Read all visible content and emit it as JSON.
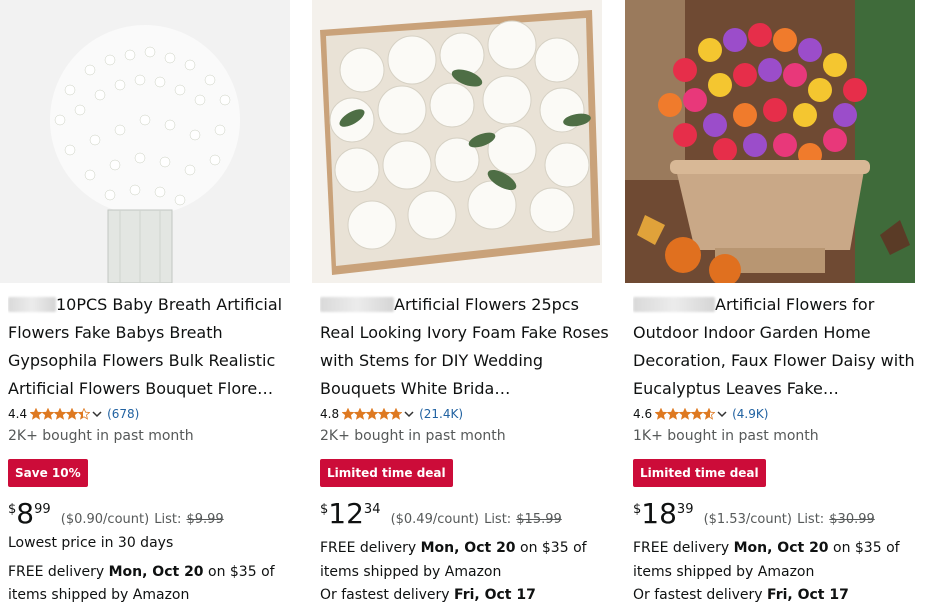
{
  "products": [
    {
      "title": "10PCS Baby Breath Artificial Flowers Fake Babys Breath Gypsophila Flowers Bulk Realistic Artificial Flowers Bouquet Flore…",
      "rating": "4.4",
      "rating_value": 4.4,
      "review_count": "(678)",
      "bought": "2K+ bought in past month",
      "badge": "Save 10%",
      "price_symbol": "$",
      "price_whole": "8",
      "price_fraction": "99",
      "unit_price": "($0.90/count)",
      "list_label": "List:",
      "list_price": "$9.99",
      "extra_line": "Lowest price in 30 days",
      "delivery_prefix": "FREE delivery ",
      "delivery_date": "Mon, Oct 20",
      "delivery_suffix": " on $35 of",
      "delivery_line2": "items shipped by Amazon"
    },
    {
      "title": "Artificial Flowers 25pcs Real Looking Ivory Foam Fake Roses with Stems for DIY Wedding Bouquets White Brida…",
      "rating": "4.8",
      "rating_value": 4.8,
      "review_count": "(21.4K)",
      "bought": "2K+ bought in past month",
      "badge": "Limited time deal",
      "price_symbol": "$",
      "price_whole": "12",
      "price_fraction": "34",
      "unit_price": "($0.49/count)",
      "list_label": "List:",
      "list_price": "$15.99",
      "delivery_prefix": "FREE delivery ",
      "delivery_date": "Mon, Oct 20",
      "delivery_suffix": " on $35 of",
      "delivery_line2": "items shipped by Amazon",
      "fastest_prefix": "Or fastest delivery ",
      "fastest_date": "Fri, Oct 17"
    },
    {
      "title": "Artificial Flowers for Outdoor Indoor Garden Home Decoration, Faux Flower Daisy with Eucalyptus Leaves Fake…",
      "rating": "4.6",
      "rating_value": 4.6,
      "review_count": "(4.9K)",
      "bought": "1K+ bought in past month",
      "badge": "Limited time deal",
      "price_symbol": "$",
      "price_whole": "18",
      "price_fraction": "39",
      "unit_price": "($1.53/count)",
      "list_label": "List:",
      "list_price": "$30.99",
      "delivery_prefix": "FREE delivery ",
      "delivery_date": "Mon, Oct 20",
      "delivery_suffix": " on $35 of",
      "delivery_line2": "items shipped by Amazon",
      "fastest_prefix": "Or fastest delivery ",
      "fastest_date": "Fri, Oct 17"
    }
  ],
  "colors": {
    "badge": "#cc0c39",
    "link": "#2162a1",
    "star": "#de7921",
    "muted": "#565959"
  },
  "icons": [
    "star-icon",
    "chevron-down-icon"
  ]
}
